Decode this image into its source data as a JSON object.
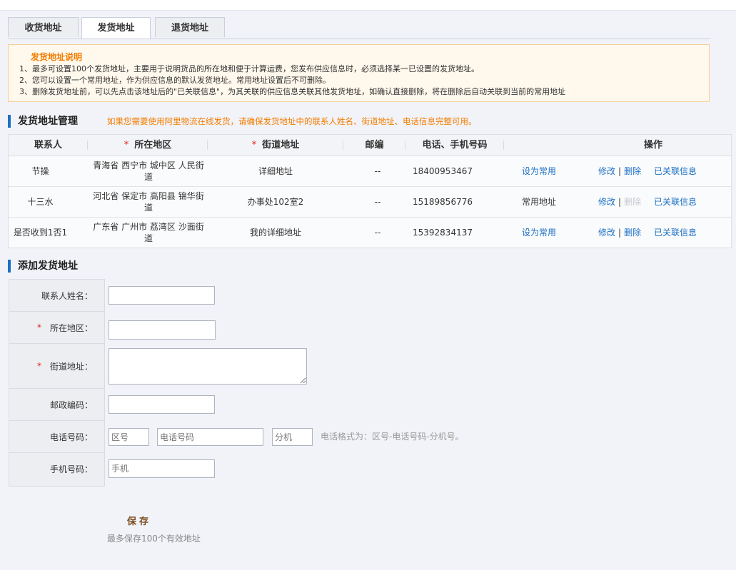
{
  "tabs": [
    {
      "label": "收货地址"
    },
    {
      "label": "发货地址"
    },
    {
      "label": "退货地址"
    }
  ],
  "notice": {
    "title": "发货地址说明",
    "lines": [
      "1、最多可设置100个发货地址，主要用于说明货品的所在地和便于计算运费，您发布供应信息时，必须选择某一已设置的发货地址。",
      "2、您可以设置一个常用地址，作为供应信息的默认发货地址。常用地址设置后不可删除。",
      "3、删除发货地址前，可以先点击该地址后的\"已关联信息\"，为其关联的供应信息关联其他发货地址，如确认直接删除，将在删除后自动关联到当前的常用地址"
    ]
  },
  "manage": {
    "title": "发货地址管理",
    "hint": "如果您需要使用阿里物流在线发货，请确保发货地址中的联系人姓名、街道地址、电话信息完整可用。",
    "columns": {
      "contact": "联系人",
      "region": "所在地区",
      "street": "街道地址",
      "zip": "邮编",
      "phone": "电话、手机号码",
      "ops": "操作"
    },
    "rows": [
      {
        "contact": "节操",
        "region": "青海省 西宁市 城中区 人民街道",
        "street": "详细地址",
        "zip": "--",
        "phone": "18400953467",
        "default_action": "设为常用",
        "edit": "修改",
        "delete": "删除",
        "linked": "已关联信息"
      },
      {
        "contact": "十三水",
        "region": "河北省 保定市 高阳县 锦华街道",
        "street": "办事处102室2",
        "zip": "--",
        "phone": "15189856776",
        "default_action": "常用地址",
        "edit": "修改",
        "delete": "删除",
        "linked": "已关联信息"
      },
      {
        "contact": "是否收到1否1",
        "region": "广东省 广州市 荔湾区 沙面街道",
        "street": "我的详细地址",
        "zip": "--",
        "phone": "15392834137",
        "default_action": "设为常用",
        "edit": "修改",
        "delete": "删除",
        "linked": "已关联信息"
      }
    ]
  },
  "add": {
    "title": "添加发货地址",
    "labels": {
      "name": "联系人姓名：",
      "region": "所在地区：",
      "street": "街道地址：",
      "zip": "邮政编码：",
      "phone": "电话号码：",
      "mobile": "手机号码："
    },
    "placeholders": {
      "area_code": "区号",
      "phone_number": "电话号码",
      "extension": "分机",
      "mobile": "手机"
    },
    "phone_hint": "电话格式为：区号-电话号码-分机号。",
    "save_label": "保存",
    "save_note": "最多保存100个有效地址",
    "required_mark": "*"
  },
  "colors": {
    "accent": "#1c6fc4",
    "warning": "#f47c00",
    "required": "#e1251b"
  }
}
